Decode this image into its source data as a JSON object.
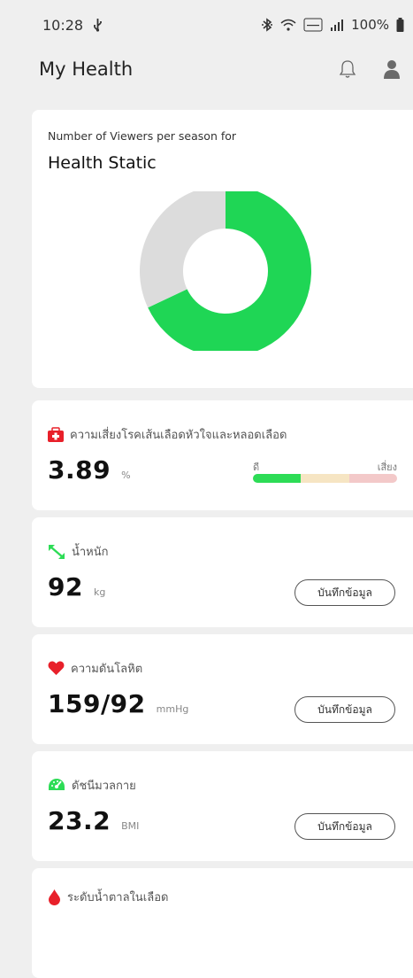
{
  "status": {
    "time": "10:28",
    "battery": "100%"
  },
  "app": {
    "title": "My Health"
  },
  "chart_card": {
    "subtitle": "Number of Viewers per season for",
    "title": "Health Static"
  },
  "chart_data": {
    "type": "pie",
    "title": "Health Static",
    "subtitle": "Number of Viewers per season for",
    "values": [
      68,
      32
    ],
    "colors": [
      "#1fd655",
      "#dcdcdc"
    ]
  },
  "metrics": [
    {
      "label": "ความเสี่ยงโรคเส้นเลือดหัวใจและหลอดเลือด",
      "value": "3.89",
      "unit": "%",
      "scale_low": "ดี",
      "scale_high": "เสี่ยง",
      "scale_colors": [
        "#2ddc56",
        "#f6e5c3",
        "#f3c9c9"
      ],
      "icon": "first-aid-kit-icon",
      "color": "#e8202a"
    },
    {
      "label": "น้ำหนัก",
      "value": "92",
      "unit": "kg",
      "button": "บันทึกข้อมูล",
      "icon": "weight-arrows-icon",
      "color": "#2ddc56"
    },
    {
      "label": "ความดันโลหิต",
      "value": "159/92",
      "unit": "mmHg",
      "button": "บันทึกข้อมูล",
      "icon": "heart-icon",
      "color": "#e8202a"
    },
    {
      "label": "ดัชนีมวลกาย",
      "value": "23.2",
      "unit": "BMI",
      "button": "บันทึกข้อมูล",
      "icon": "gauge-icon",
      "color": "#2ddc56"
    },
    {
      "label": "ระดับน้ำตาลในเลือด",
      "icon": "blood-drop-icon",
      "color": "#e8202a"
    }
  ]
}
